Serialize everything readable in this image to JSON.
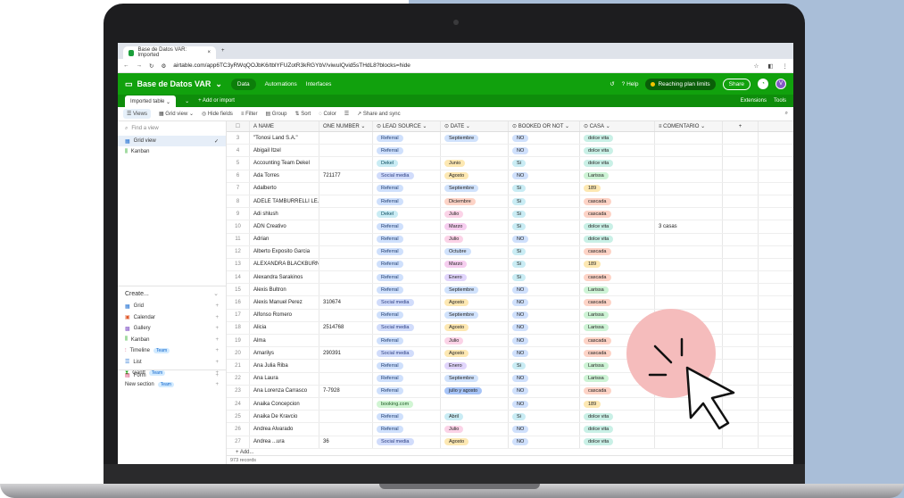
{
  "browser": {
    "tab_title": "Base de Datos VAR: Imported",
    "url": "airtable.com/app6TC3yRWqQOJbK6/tblYFUZotR3kRGYbV/viwuIQvid5sTHdL8?blocks=hide"
  },
  "header": {
    "base_title": "Base de Datos VAR",
    "nav": [
      "Data",
      "Automations",
      "Interfaces"
    ],
    "help": "Help",
    "limit": "Reaching plan limits",
    "share": "Share",
    "avatar": "V"
  },
  "tablebar": {
    "table": "Imported table",
    "add_import": "+ Add or import",
    "extensions": "Extensions",
    "tools": "Tools"
  },
  "toolbar": {
    "views": "Views",
    "grid_view": "Grid view",
    "hide_fields": "Hide fields",
    "filter": "Filter",
    "group": "Group",
    "sort": "Sort",
    "color": "Color",
    "share_sync": "Share and sync"
  },
  "sidebar": {
    "find_placeholder": "Find a view",
    "views": [
      "Grid view",
      "Kanban"
    ],
    "create_title": "Create...",
    "create_items": [
      "Grid",
      "Calendar",
      "Gallery",
      "Kanban",
      "Timeline",
      "List",
      "Gantt",
      "New section"
    ],
    "team_label": "Team",
    "form": "Form"
  },
  "grid": {
    "headers": [
      "NAME",
      "ONE NUMBER",
      "LEAD SOURCE",
      "DATE",
      "BOOKED OR NOT",
      "CASA",
      "COMENTARIO"
    ],
    "rows": [
      [
        "3",
        "\"Tonosi Land S.A.\"",
        "",
        "Referral",
        "Septiembre",
        "NO",
        "dolce vita",
        ""
      ],
      [
        "4",
        "Abigail Itzel",
        "",
        "Referral",
        "",
        "NO",
        "dolce vita",
        ""
      ],
      [
        "5",
        "Accounting Team Dekel",
        "",
        "Dekel",
        "Junio",
        "Si",
        "dolce vita",
        ""
      ],
      [
        "6",
        "Ada Torres",
        "721177",
        "Social media",
        "Agosto",
        "NO",
        "Larissa",
        ""
      ],
      [
        "7",
        "Adalberto",
        "",
        "Referral",
        "Septiembre",
        "Si",
        "189",
        ""
      ],
      [
        "8",
        "ADELE TAMBURRELLI LE...",
        "",
        "Referral",
        "Diciembre",
        "Si",
        "cascada",
        ""
      ],
      [
        "9",
        "Adi shlush",
        "",
        "Dekel",
        "Julio",
        "Si",
        "cascada",
        ""
      ],
      [
        "10",
        "ADN Creativo",
        "",
        "Referral",
        "Marzo",
        "Si",
        "dolce vita",
        "3 casas"
      ],
      [
        "11",
        "Adrian",
        "",
        "Referral",
        "Julio",
        "NO",
        "dolce vita",
        ""
      ],
      [
        "12",
        "Alberto Exposito Garcia",
        "",
        "Referral",
        "Octubre",
        "Si",
        "cascada",
        ""
      ],
      [
        "13",
        "ALEXANDRA BLACKBURN",
        "",
        "Referral",
        "Marzo",
        "Si",
        "189",
        ""
      ],
      [
        "14",
        "Alexandra Sarakinos",
        "",
        "Referral",
        "Enero",
        "Si",
        "cascada",
        ""
      ],
      [
        "15",
        "Alexis Bultron",
        "",
        "Referral",
        "Septiembre",
        "NO",
        "Larissa",
        ""
      ],
      [
        "16",
        "Alexis Manuel Perez",
        "310674",
        "Social media",
        "Agosto",
        "NO",
        "cascada",
        ""
      ],
      [
        "17",
        "Alfonso Romero",
        "",
        "Referral",
        "Septiembre",
        "NO",
        "Larissa",
        ""
      ],
      [
        "18",
        "Alicia",
        "2514768",
        "Social media",
        "Agosto",
        "NO",
        "Larissa",
        ""
      ],
      [
        "19",
        "Alma",
        "",
        "Referral",
        "Julio",
        "NO",
        "cascada",
        ""
      ],
      [
        "20",
        "Amarilys",
        "290391",
        "Social media",
        "Agosto",
        "NO",
        "cascada",
        ""
      ],
      [
        "21",
        "Ana Julia Riba",
        "",
        "Referral",
        "Enero",
        "Si",
        "Larissa",
        ""
      ],
      [
        "22",
        "Ana Laura",
        "",
        "Referral",
        "Septiembre",
        "NO",
        "Larissa",
        ""
      ],
      [
        "23",
        "Ana Lorenza Carrasco",
        "7-7928",
        "Referral",
        "julio y agosto",
        "NO",
        "cascada",
        ""
      ],
      [
        "24",
        "Anaika Concepcion",
        "",
        "booking.com",
        "",
        "NO",
        "189",
        ""
      ],
      [
        "25",
        "Anaika De Kravcio",
        "",
        "Referral",
        "Abril",
        "Si",
        "dolce vita",
        ""
      ],
      [
        "26",
        "Andrea Alvarado",
        "",
        "Referral",
        "Julio",
        "NO",
        "dolce vita",
        ""
      ],
      [
        "27",
        "Andrea ...ura",
        "36",
        "Social media",
        "Agosto",
        "NO",
        "dolce vita",
        ""
      ]
    ],
    "add_label": "+  Add...",
    "records": "973 records"
  },
  "colors": {
    "airtable_green": "#11a10d",
    "background_blue": "#a9bed8",
    "cursor_highlight": "#f5bcbc"
  }
}
